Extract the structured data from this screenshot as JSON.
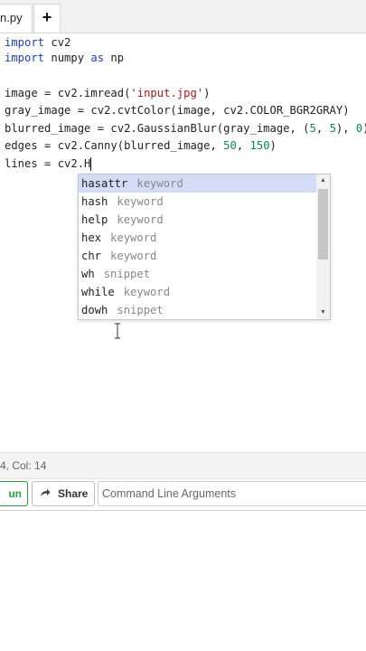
{
  "tabs": {
    "active_label": "n.py",
    "add_label": "+"
  },
  "editor": {
    "lines": [
      {
        "prefix": "",
        "kw": "import",
        "rest": " cv2"
      },
      {
        "prefix": "",
        "kw": "import",
        "rest": " numpy ",
        "kw2": "as",
        "rest2": " np"
      },
      {
        "text": ""
      },
      {
        "text": "image = cv2.imread(",
        "str": "'input.jpg'",
        "after": ")"
      },
      {
        "text": "gray_image = cv2.cvtColor(image, cv2.COLOR_BGR2GRAY)"
      },
      {
        "text": "blurred_image = cv2.GaussianBlur(gray_image, (",
        "n1": "5",
        "mid": ", ",
        "n2": "5",
        "mid2": "), ",
        "n3": "0",
        "after": ")"
      },
      {
        "text": "edges = cv2.Canny(blurred_image, ",
        "n1": "50",
        "mid": ", ",
        "n2": "150",
        "after": ")"
      },
      {
        "text": "lines = cv2.H"
      }
    ]
  },
  "autocomplete": {
    "items": [
      {
        "name": "hasattr",
        "kind": "keyword"
      },
      {
        "name": "hash",
        "kind": "keyword"
      },
      {
        "name": "help",
        "kind": "keyword"
      },
      {
        "name": "hex",
        "kind": "keyword"
      },
      {
        "name": "chr",
        "kind": "keyword"
      },
      {
        "name": "wh",
        "kind": "snippet"
      },
      {
        "name": "while",
        "kind": "keyword"
      },
      {
        "name": "dowh",
        "kind": "snippet"
      }
    ],
    "scroll_up": "▲",
    "scroll_down": "▼"
  },
  "status": {
    "position": "4, Col: 14"
  },
  "toolbar": {
    "run_label": "un",
    "share_label": "Share",
    "share_icon": "share-arrow-icon",
    "args_placeholder": "Command Line Arguments"
  }
}
